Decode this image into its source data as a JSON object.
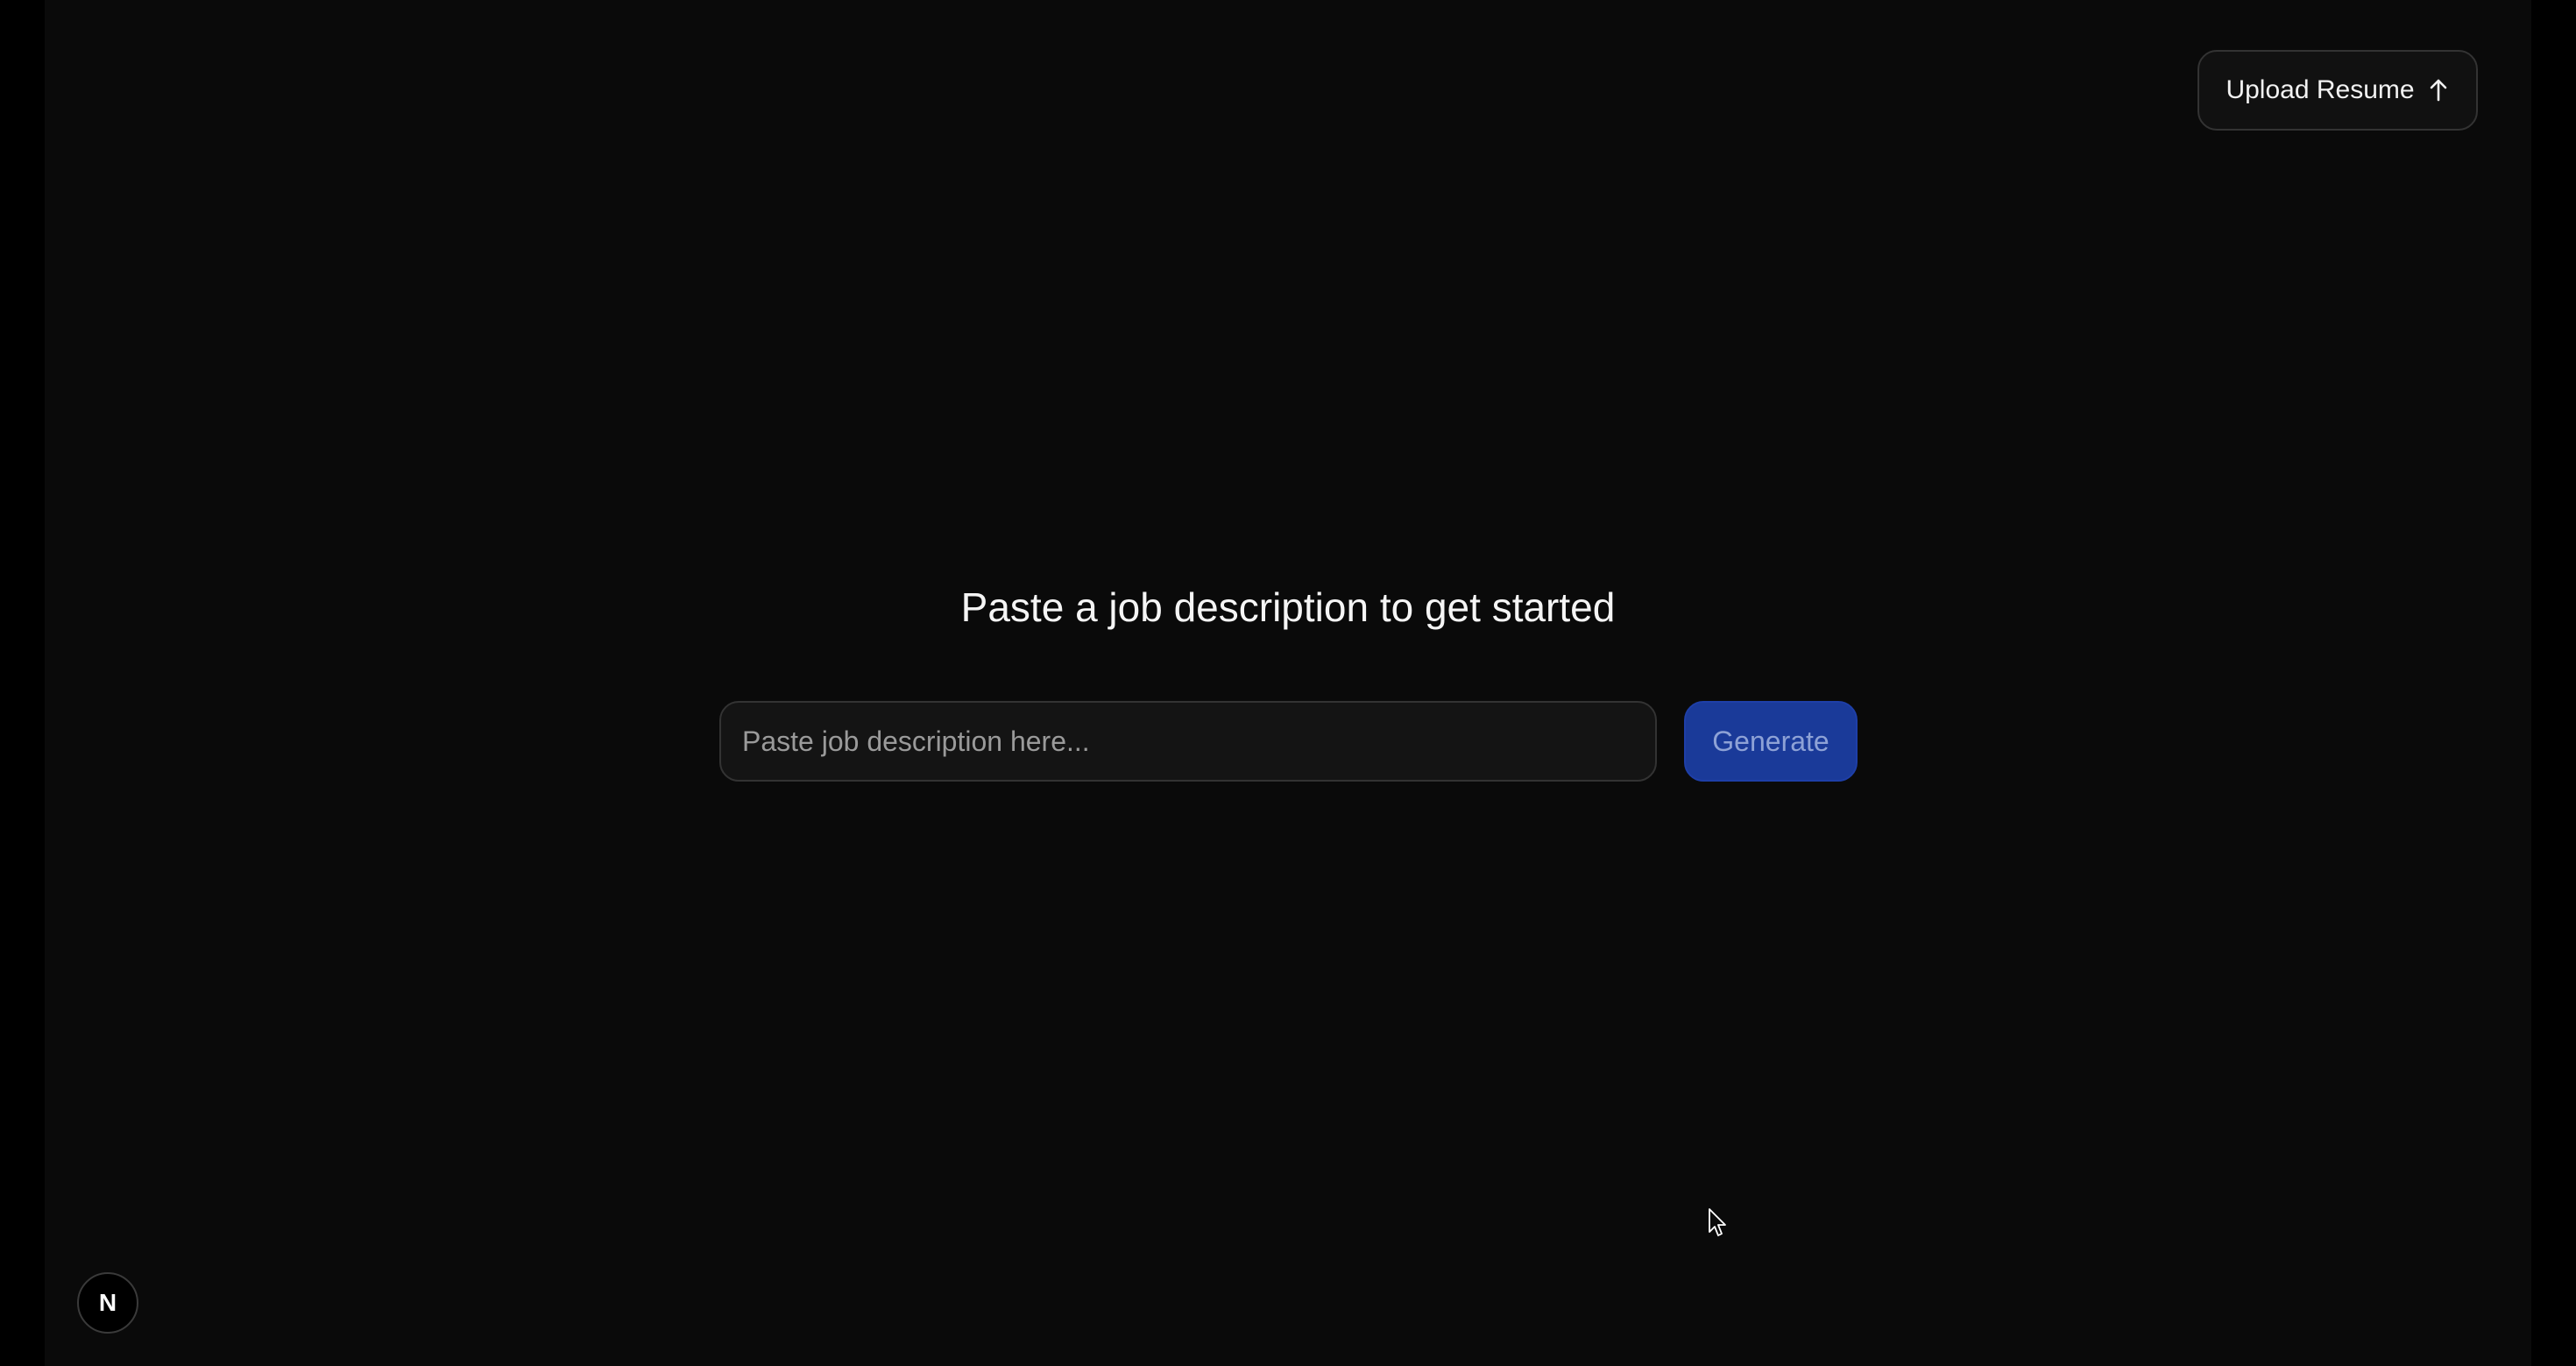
{
  "header": {
    "upload_label": "Upload Resume",
    "upload_icon": "arrow-up-icon"
  },
  "main": {
    "title": "Paste a job description to get started",
    "input": {
      "value": "",
      "placeholder": "Paste job description here..."
    },
    "generate_label": "Generate"
  },
  "footer": {
    "badge_letter": "N",
    "badge_icon": "nextjs-logo-icon"
  },
  "colors": {
    "background": "#0a0a0a",
    "accent": "#1a3a99",
    "accent_text": "#8ea2d6",
    "border": "#333333",
    "text": "#f5f5f5"
  }
}
